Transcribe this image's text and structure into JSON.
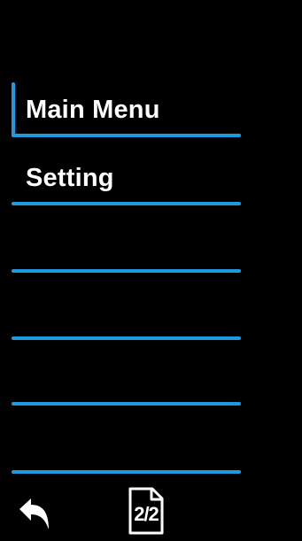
{
  "colors": {
    "background": "#000000",
    "accent": "#1e9be0",
    "text": "#ffffff"
  },
  "menu": {
    "items": [
      {
        "label": "Main Menu",
        "selected": true
      },
      {
        "label": "Setting",
        "selected": false
      },
      {
        "label": "",
        "selected": false
      },
      {
        "label": "",
        "selected": false
      },
      {
        "label": "",
        "selected": false
      },
      {
        "label": "",
        "selected": false
      }
    ]
  },
  "footer": {
    "back_icon": "back-arrow-icon",
    "page_icon": "page-indicator-icon",
    "page_indicator": "2/2"
  }
}
